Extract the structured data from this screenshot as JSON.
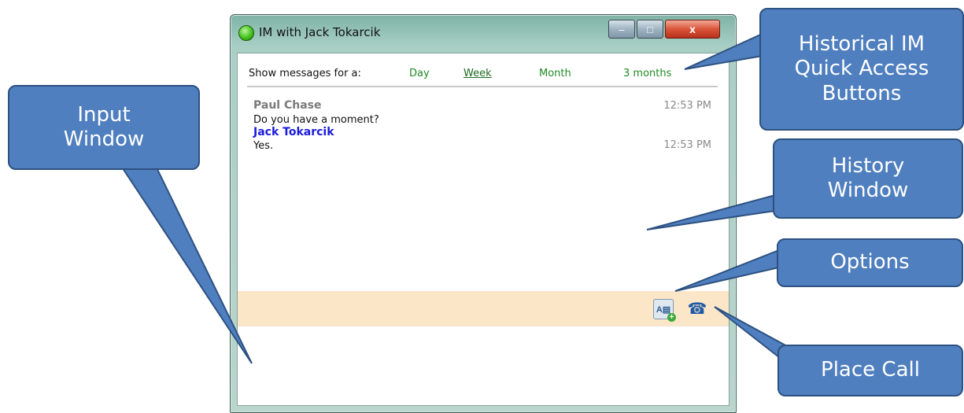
{
  "window": {
    "title": "IM with Jack Tokarcik",
    "min_glyph": "–",
    "max_glyph": "□",
    "close_glyph": "x"
  },
  "filter": {
    "label": "Show messages for a:",
    "options": [
      "Day",
      "Week",
      "Month",
      "3 months"
    ],
    "selected": "Week"
  },
  "history": {
    "messages": [
      {
        "sender": "Paul Chase",
        "time": "12:53 PM",
        "text": "Do you have a moment?",
        "sender_color": "#7a7a7a"
      },
      {
        "sender": "Jack Tokarcik",
        "time": "12:53 PM",
        "text": "Yes.",
        "sender_color": "#1a1adb"
      }
    ]
  },
  "toolbar": {
    "options_icon": "options-icon",
    "call_icon": "phone-icon"
  },
  "input": {
    "value": ""
  },
  "callouts": {
    "input_window": [
      "Input",
      "Window"
    ],
    "historical": [
      "Historical IM",
      "Quick Access",
      "Buttons"
    ],
    "history_window": [
      "History",
      "Window"
    ],
    "options": [
      "Options"
    ],
    "place_call": [
      "Place Call"
    ]
  },
  "colors": {
    "callout_fill": "#4f7fbf",
    "toolbar_bg": "#fbe6c8",
    "link_green": "#1f8a22"
  }
}
